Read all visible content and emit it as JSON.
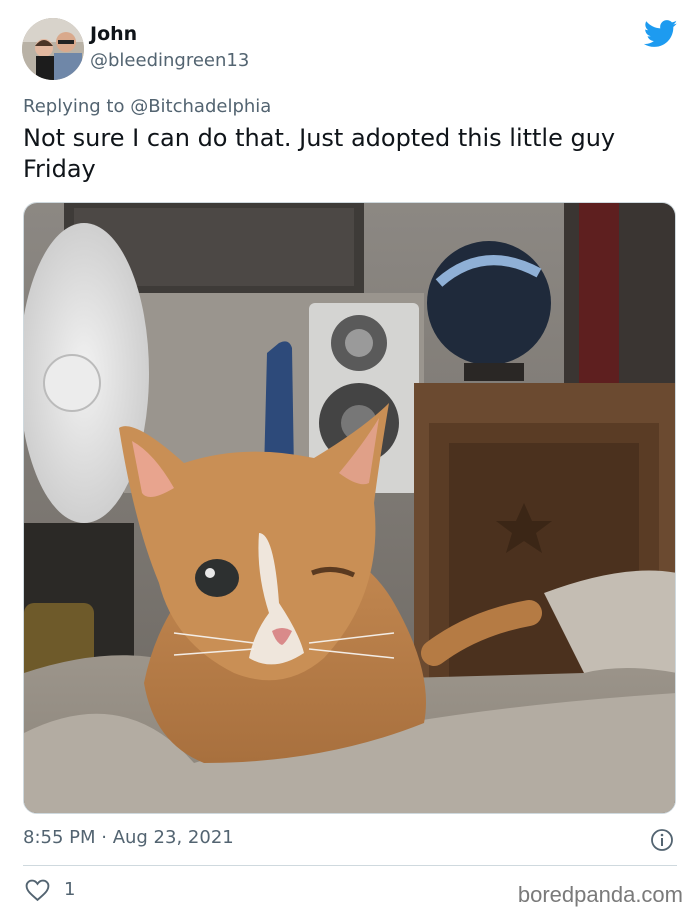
{
  "author": {
    "name": "John",
    "handle": "@bleedingreen13"
  },
  "reply": {
    "prefix": "Replying to ",
    "mention": "@Bitchadelphia"
  },
  "tweet_text": "Not sure I can do that. Just adopted this little guy Friday",
  "timestamp": "8:55 PM · Aug 23, 2021",
  "likes": "1",
  "watermark": "boredpanda.com",
  "colors": {
    "twitter_blue": "#1d9bf0",
    "secondary_text": "#536471",
    "divider": "#cfd9de"
  },
  "icons": {
    "brand": "twitter-bird-icon",
    "info": "info-icon",
    "like": "heart-icon"
  }
}
